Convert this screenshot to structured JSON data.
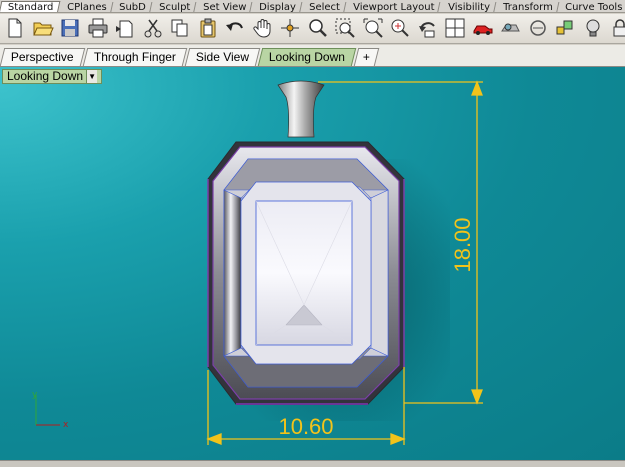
{
  "toolbar_tabs": [
    {
      "label": "Standard",
      "active": true
    },
    {
      "label": "CPlanes"
    },
    {
      "label": "SubD"
    },
    {
      "label": "Sculpt"
    },
    {
      "label": "Set View"
    },
    {
      "label": "Display"
    },
    {
      "label": "Select"
    },
    {
      "label": "Viewport Layout"
    },
    {
      "label": "Visibility"
    },
    {
      "label": "Transform"
    },
    {
      "label": "Curve Tools"
    }
  ],
  "toolbar_icons": [
    "new-file-icon",
    "open-folder-icon",
    "save-icon",
    "print-icon",
    "import-icon",
    "cut-icon",
    "copy-icon",
    "paste-icon",
    "undo-icon",
    "pan-hand-icon",
    "rotate-view-icon",
    "zoom-icon",
    "zoom-window-icon",
    "zoom-extents-icon",
    "zoom-selected-icon",
    "undo-view-icon",
    "four-viewports-icon",
    "car-model-icon",
    "render-icon",
    "curve-icon",
    "layer-icon",
    "light-bulb-icon",
    "lock-icon",
    "material-icon"
  ],
  "viewport_tabs": [
    {
      "label": "Perspective"
    },
    {
      "label": "Through Finger"
    },
    {
      "label": "Side View"
    },
    {
      "label": "Looking Down",
      "active": true
    }
  ],
  "add_viewport_label": "+",
  "viewport": {
    "name": "Looking Down",
    "dimension_height": "18.00",
    "dimension_width": "10.60",
    "axis_x_label": "x",
    "axis_y_label": "y"
  },
  "colors": {
    "viewport_bg": "#1aa0ad",
    "dimension": "#f2c31a",
    "active_tab": "#b9d5a4"
  }
}
